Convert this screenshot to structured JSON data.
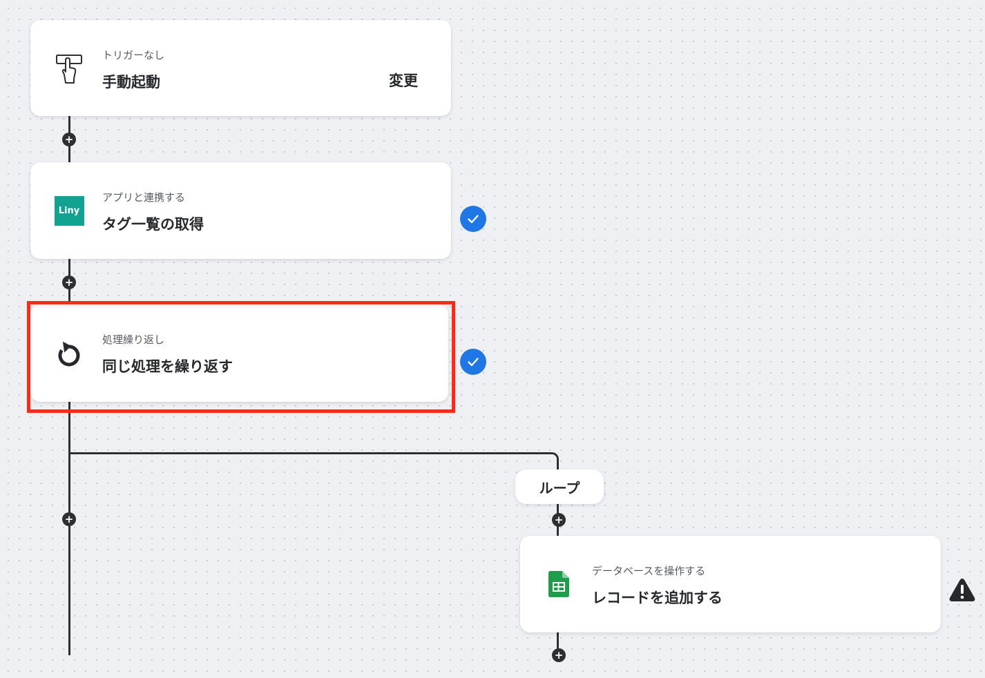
{
  "steps": [
    {
      "subtitle": "トリガーなし",
      "title": "手動起動",
      "action_label": "変更",
      "icon": "manual-trigger-icon"
    },
    {
      "subtitle": "アプリと連携する",
      "title": "タグ一覧の取得",
      "icon": "liny-app-icon",
      "icon_text": "Liny",
      "status": "completed"
    },
    {
      "subtitle": "処理繰り返し",
      "title": "同じ処理を繰り返す",
      "icon": "loop-icon",
      "status": "completed",
      "highlighted": true
    },
    {
      "subtitle": "データベースを操作する",
      "title": "レコードを追加する",
      "icon": "google-sheets-icon",
      "status": "warning"
    }
  ],
  "loop_label": "ループ",
  "add_symbol": "+",
  "colors": {
    "check": "#1f77e6",
    "highlight": "#ff2a10",
    "liny": "#12a292",
    "sheets": "#188038",
    "line": "#2d2f33"
  }
}
